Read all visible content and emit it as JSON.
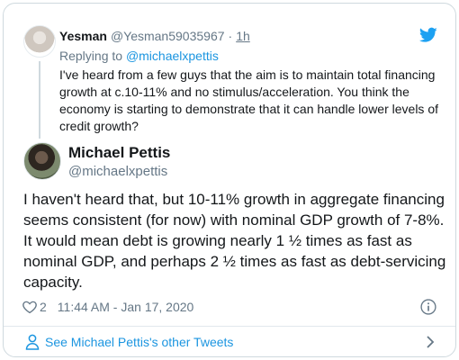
{
  "parent_tweet": {
    "author_name": "Yesman",
    "author_handle": "@Yesman59035967",
    "separator": "·",
    "time_ago": "1h",
    "replying_prefix": "Replying to",
    "replying_to": "@michaelxpettis",
    "text": "I've heard from a few guys that the aim is to maintain total financing growth at c.10-11% and no stimulus/acceleration. You think the economy is starting to demonstrate that it can handle lower levels of credit growth?"
  },
  "main_tweet": {
    "author_name": "Michael Pettis",
    "author_handle": "@michaelxpettis",
    "text": "I haven't heard that, but 10-11% growth in aggregate financing seems consistent (for now) with nominal GDP growth of 7-8%. It would mean debt is growing nearly 1 ½ times as fast as nominal GDP, and perhaps 2 ½ times as fast as debt-servicing capacity.",
    "like_count": "2",
    "timestamp": "11:44 AM - Jan 17, 2020"
  },
  "footer": {
    "link_label": "See Michael Pettis's other Tweets"
  },
  "icons": {
    "brand": "twitter-bird-icon",
    "like": "heart-icon",
    "info": "info-icon",
    "profile": "person-icon",
    "more": "chevron-right-icon"
  },
  "colors": {
    "brand_blue": "#1da1f2",
    "link_blue": "#1b95e0",
    "secondary_text": "#657786",
    "border": "#cfd9de"
  }
}
